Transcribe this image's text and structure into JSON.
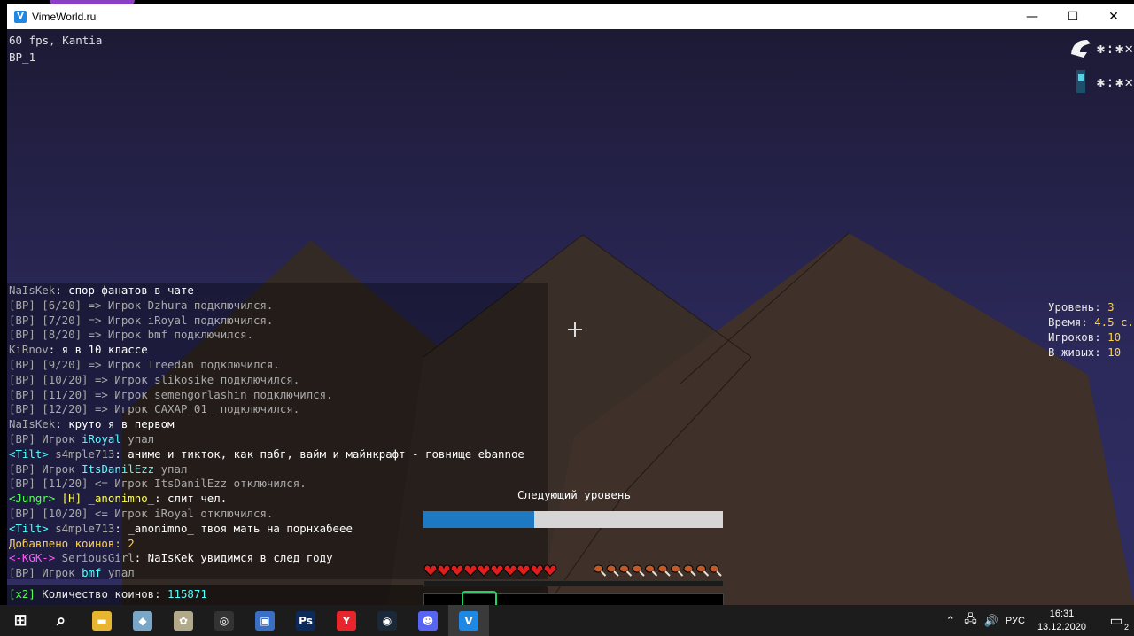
{
  "window": {
    "title": "VimeWorld.ru",
    "app_icon_glyph": "V",
    "minimize_label": "—",
    "maximize_label": "☐",
    "close_label": "✕"
  },
  "debug": {
    "fps_line": "60 fps, Kantia",
    "server_line": "BP_1"
  },
  "scoreboard_players": [
    {
      "icon": "wolf-head-icon",
      "name": "✱:✱✕"
    },
    {
      "icon": "player-skin-icon",
      "name": "✱:✱✕"
    }
  ],
  "chat": [
    [
      {
        "t": "NaIsKek",
        "c": "g"
      },
      {
        "t": ": спор фанатов в чате",
        "c": "w"
      }
    ],
    [
      {
        "t": "[BP] [6/20] => Игрок Dzhura подключился.",
        "c": "g"
      }
    ],
    [
      {
        "t": "[BP] [7/20] => Игрок iRoyal подключился.",
        "c": "g"
      }
    ],
    [
      {
        "t": "[BP] [8/20] => Игрок bmf подключился.",
        "c": "g"
      }
    ],
    [
      {
        "t": "KiRnov",
        "c": "g"
      },
      {
        "t": ": я в 10 классе",
        "c": "w"
      }
    ],
    [
      {
        "t": "[BP] [9/20] => Игрок Treedan подключился.",
        "c": "g"
      }
    ],
    [
      {
        "t": "[BP] [10/20] => Игрок slikosike подключился.",
        "c": "g"
      }
    ],
    [
      {
        "t": "[BP] [11/20] => Игрок semengorlashin подключился.",
        "c": "g"
      }
    ],
    [
      {
        "t": "[BP] [12/20] => Игрок CAXAP_01_ подключился.",
        "c": "g"
      }
    ],
    [
      {
        "t": "NaIsKek",
        "c": "g"
      },
      {
        "t": ": круто я в первом",
        "c": "w"
      }
    ],
    [
      {
        "t": "[BP] Игрок ",
        "c": "g"
      },
      {
        "t": "iRoyal",
        "c": "a"
      },
      {
        "t": " упал",
        "c": "g"
      }
    ],
    [
      {
        "t": "<Tilt>",
        "c": "a"
      },
      {
        "t": " s4mple713",
        "c": "g"
      },
      {
        "t": ": аниме и тикток, как пабг, вайм и майнкрафт - говнище ebannoe",
        "c": "w"
      }
    ],
    [
      {
        "t": "[BP] Игрок ",
        "c": "g"
      },
      {
        "t": "ItsDanilEzz",
        "c": "a"
      },
      {
        "t": " упал",
        "c": "g"
      }
    ],
    [
      {
        "t": "[BP] [11/20] <= Игрок ItsDanilEzz отключился.",
        "c": "g"
      }
    ],
    [
      {
        "t": "<Jungr>",
        "c": "gr"
      },
      {
        "t": " [H] _anonimno_",
        "c": "y"
      },
      {
        "t": ": слит чел.",
        "c": "w"
      }
    ],
    [
      {
        "t": "[BP] [10/20] <= Игрок iRoyal отключился.",
        "c": "g"
      }
    ],
    [
      {
        "t": "<Tilt>",
        "c": "a"
      },
      {
        "t": " s4mple713",
        "c": "g"
      },
      {
        "t": ": _anonimno_ твоя мать на порнхабееe",
        "c": "w"
      }
    ],
    [
      {
        "t": "Добавлено коинов: 2",
        "c": "ye"
      }
    ],
    [
      {
        "t": "<-KGK->",
        "c": "p"
      },
      {
        "t": " SeriousGirl",
        "c": "g"
      },
      {
        "t": ": NaIsKek увидимся в след году",
        "c": "w"
      }
    ],
    [
      {
        "t": "[BP] Игрок ",
        "c": "g"
      },
      {
        "t": "bmf",
        "c": "a"
      },
      {
        "t": " упал",
        "c": "g"
      }
    ]
  ],
  "coins_line": {
    "multiplier": "[x2]",
    "label": " Количество коинов: ",
    "value": "115871"
  },
  "stats": {
    "level_label": "Уровень: ",
    "level_value": "3",
    "time_label": "Время: ",
    "time_value": "4.5 с.",
    "players_label": "Игроков: ",
    "players_value": "10",
    "alive_label": "В живых: ",
    "alive_value": "10"
  },
  "next_level": {
    "title": "Следующий уровень",
    "progress": 0.37
  },
  "hud": {
    "hearts": 10,
    "hunger": 10,
    "hotbar_selected_slot": 2,
    "heart_color": "#e01e1e",
    "hunger_color": "#c05a2a"
  },
  "colors": {
    "accent": "#1f78c2",
    "window_bg": "#ffffff",
    "taskbar_bg": "#1c1c1c"
  },
  "taskbar": {
    "apps": [
      {
        "name": "windows-start-icon",
        "glyph": "⊞",
        "bg": "transparent"
      },
      {
        "name": "search-icon",
        "glyph": "⌕",
        "bg": "transparent"
      },
      {
        "name": "file-explorer-icon",
        "glyph": "▬",
        "bg": "#e8b530"
      },
      {
        "name": "pinned-app-icon-1",
        "glyph": "◆",
        "bg": "#7aa7c7"
      },
      {
        "name": "pinned-app-icon-2",
        "glyph": "✿",
        "bg": "#b2a98a"
      },
      {
        "name": "obs-icon",
        "glyph": "◎",
        "bg": "#333"
      },
      {
        "name": "video-editor-icon",
        "glyph": "▣",
        "bg": "#3a6fc4"
      },
      {
        "name": "photoshop-icon",
        "glyph": "Ps",
        "bg": "#0b2a5a"
      },
      {
        "name": "yandex-browser-icon",
        "glyph": "Y",
        "bg": "#e9242b"
      },
      {
        "name": "steam-icon",
        "glyph": "◉",
        "bg": "#1b2838"
      },
      {
        "name": "discord-icon",
        "glyph": "☻",
        "bg": "#5865f2"
      },
      {
        "name": "vimeworld-icon",
        "glyph": "V",
        "bg": "#1e88e5"
      }
    ],
    "tray": {
      "language": "РУС",
      "time": "16:31",
      "date": "13.12.2020",
      "notifications": "2"
    }
  }
}
